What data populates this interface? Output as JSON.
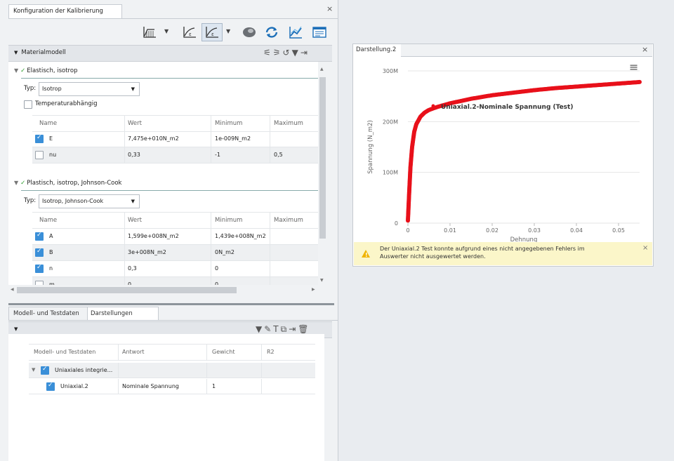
{
  "left_panel": {
    "tab_title": "Konfiguration der Kalibrierung",
    "close_glyph": "×",
    "toolbar": {
      "icons": [
        "stress-strain-curve-icon",
        "dropdown-arrow",
        "strain-icon",
        "strain-rate-icon",
        "dropdown-arrow",
        "shape-icon",
        "refresh-icon",
        "chart-edit-icon",
        "table-view-icon"
      ]
    },
    "material_section": {
      "title": "Materialmodell",
      "header_icons": [
        "filter-add-icon",
        "filter-remove-icon",
        "undo-icon",
        "funnel-icon",
        "export-icon"
      ],
      "elastic": {
        "title": "Elastisch, isotrop",
        "typ_label": "Typ:",
        "typ_value": "Isotrop",
        "temp_label": "Temperaturabhängig",
        "columns": [
          "Name",
          "Wert",
          "Minimum",
          "Maximum"
        ],
        "rows": [
          {
            "name": "E",
            "wert": "7,475e+010N_m2",
            "min": "1e-009N_m2",
            "max": "",
            "checked": true
          },
          {
            "name": "nu",
            "wert": "0,33",
            "min": "-1",
            "max": "0,5",
            "checked": false
          }
        ]
      },
      "plastic": {
        "title": "Plastisch, isotrop, Johnson-Cook",
        "typ_label": "Typ:",
        "typ_value": "Isotrop, Johnson-Cook",
        "columns": [
          "Name",
          "Wert",
          "Minimum",
          "Maximum"
        ],
        "rows": [
          {
            "name": "A",
            "wert": "1,599e+008N_m2",
            "min": "1,439e+008N_m2",
            "max": "",
            "checked": true
          },
          {
            "name": "B",
            "wert": "3e+008N_m2",
            "min": "0N_m2",
            "max": "",
            "checked": true
          },
          {
            "name": "n",
            "wert": "0,3",
            "min": "0",
            "max": "",
            "checked": true
          },
          {
            "name": "m",
            "wert": "0",
            "min": "0",
            "max": "",
            "checked": false
          }
        ]
      }
    },
    "bottom": {
      "tabs": [
        "Modell- und Testdaten",
        "Darstellungen"
      ],
      "header_icons": [
        "funnel-icon",
        "pencil-icon",
        "text-icon",
        "copy-icon",
        "export-icon",
        "delete-icon"
      ],
      "columns": [
        "Modell- und Testdaten",
        "Antwort",
        "Gewicht",
        "R2"
      ],
      "rows": [
        {
          "name": "Uniaxiales integrie...",
          "antwort": "",
          "gewicht": "",
          "r2": ""
        },
        {
          "name": "Uniaxial.2",
          "antwort": "Nominale Spannung",
          "gewicht": "1",
          "r2": ""
        }
      ]
    }
  },
  "right_panel": {
    "tab_title": "Darstellung.2",
    "close_glyph": "×",
    "menu_glyph": "≡",
    "warning_text_line1": "Der Uniaxial.2 Test konnte aufgrund eines nicht angegebenen Fehlers im",
    "warning_text_line2": "Auswerter nicht ausgewertet werden.",
    "warning_close": "×"
  },
  "chart_data": {
    "type": "scatter",
    "ylabel": "Spannung (N_m2)",
    "xlabel": "Dehnung",
    "x_ticks": [
      "0",
      "0.01",
      "0.02",
      "0.03",
      "0.04",
      "0.05"
    ],
    "y_ticks": [
      "0",
      "100M",
      "200M",
      "300M"
    ],
    "xlim": [
      0,
      0.055
    ],
    "ylim": [
      0,
      300000000
    ],
    "legend": "Uniaxial.2-Nominale Spannung (Test)",
    "series": [
      {
        "name": "Uniaxial.2-Nominale Spannung (Test)",
        "color": "#e8101a",
        "x": [
          0,
          0.0003,
          0.0006,
          0.001,
          0.0015,
          0.002,
          0.003,
          0.004,
          0.005,
          0.007,
          0.01,
          0.015,
          0.02,
          0.025,
          0.03,
          0.035,
          0.04,
          0.045,
          0.05,
          0.055
        ],
        "y": [
          5000000,
          60000000,
          110000000,
          150000000,
          180000000,
          195000000,
          210000000,
          218000000,
          223000000,
          229000000,
          236000000,
          245000000,
          252000000,
          257000000,
          262000000,
          266000000,
          269000000,
          272000000,
          275000000,
          278000000
        ]
      }
    ]
  }
}
